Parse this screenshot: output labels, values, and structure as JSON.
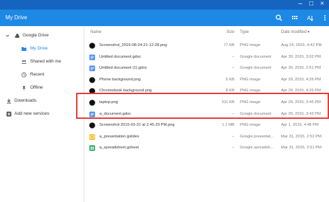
{
  "window": {
    "minimize_glyph": "–",
    "maximize_glyph": "□",
    "close_glyph": "×"
  },
  "appbar": {
    "title": "My Drive",
    "icons": [
      "search-icon",
      "grid-view-icon",
      "sort-icon",
      "more-icon"
    ]
  },
  "sidebar": {
    "root": {
      "label": "Google Drive",
      "icon": "drive-icon",
      "expanded": true
    },
    "items": [
      {
        "label": "My Drive",
        "icon": "folder-icon",
        "selected": true
      },
      {
        "label": "Shared with me",
        "icon": "people-icon"
      },
      {
        "label": "Recent",
        "icon": "clock-icon"
      },
      {
        "label": "Offline",
        "icon": "pin-icon"
      }
    ],
    "downloads": {
      "label": "Downloads",
      "icon": "download-icon"
    },
    "add_services": {
      "label": "Add new services",
      "icon": "add-box-icon"
    }
  },
  "table": {
    "columns": {
      "name": "Name",
      "size": "Size",
      "type": "Type",
      "date": "Date modified ▾"
    },
    "rows": [
      {
        "name": "Screenshot_2015-08-24-21-12-28.png",
        "size": "77 KB",
        "type": "PNG image",
        "date": "Aug 24, 2015, 4:42 PM",
        "icon": "image-thumb-icon"
      },
      {
        "name": "Untitled document.gdoc",
        "size": "--",
        "type": "Google document",
        "date": "Apr 30, 2015, 3:02 PM",
        "icon": "gdoc-icon"
      },
      {
        "name": "Untitled document (1).gdoc",
        "size": "--",
        "type": "Google document",
        "date": "Apr 30, 2015, 2:51 PM",
        "icon": "gdoc-icon"
      },
      {
        "name": "Phone background.png",
        "size": "5 KB",
        "type": "PNG image",
        "date": "Apr 29, 2015, 4:26 PM",
        "icon": "image-thumb-icon"
      },
      {
        "name": "Chromebook background.png",
        "size": "8 KB",
        "type": "PNG image",
        "date": "Apr 29, 2015, 4:26 PM",
        "icon": "image-thumb-icon"
      },
      {
        "name": "laptop.png",
        "size": "311 KB",
        "type": "PNG image",
        "date": "Apr 29, 2015, 3:45 PM",
        "icon": "image-thumb-icon"
      },
      {
        "name": "a_document.gdoc",
        "size": "--",
        "type": "Google document",
        "date": "Apr 29, 2015, 3:43 PM",
        "icon": "gdoc-icon"
      },
      {
        "name": "Screenshot 2015-03-31 at 2.45.29 PM.png",
        "size": "1.1 MB",
        "type": "PNG image",
        "date": "Apr 1, 2015, 4:48 PM",
        "icon": "image-thumb-icon"
      },
      {
        "name": "a_presentation.gslides",
        "size": "--",
        "type": "Google presentat...",
        "date": "Mar 31, 2015, 2:52 PM",
        "icon": "gslides-icon"
      },
      {
        "name": "a_spreadsheet.gsheet",
        "size": "--",
        "type": "Google spreadsh...",
        "date": "Mar 31, 2015, 2:51 PM",
        "icon": "gsheet-icon"
      }
    ]
  },
  "colors": {
    "titlebar": "#1565c0",
    "appbar": "#1e88e5",
    "accent": "#1e88e5",
    "highlight_box": "#e53935",
    "gdoc": "#4285f4",
    "gslides": "#f4b400",
    "gsheet": "#0f9d58"
  }
}
